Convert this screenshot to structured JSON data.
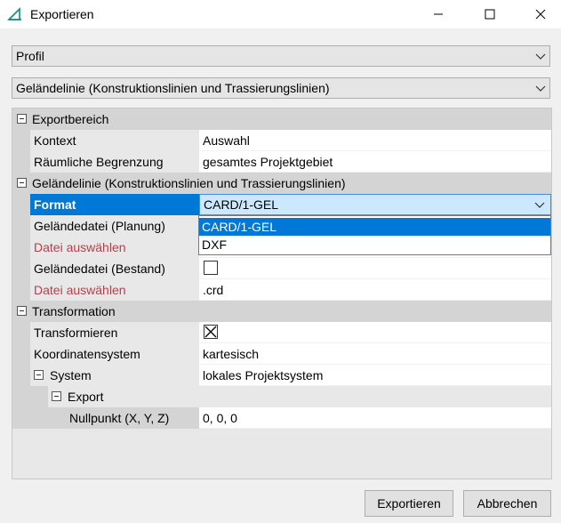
{
  "window": {
    "title": "Exportieren"
  },
  "combos": {
    "profile": "Profil",
    "object": "Geländelinie (Konstruktionslinien und Trassierungslinien)"
  },
  "grid": {
    "export_area": {
      "label": "Exportbereich",
      "context_label": "Kontext",
      "context_value": "Auswahl",
      "spatial_label": "Räumliche Begrenzung",
      "spatial_value": "gesamtes Projektgebiet"
    },
    "terrain": {
      "label": "Geländelinie (Konstruktionslinien und Trassierungslinien)",
      "format_label": "Format",
      "format_value": "CARD/1-GEL",
      "planning_label": "Geländedatei (Planung)",
      "choose_file_1": "Datei auswählen",
      "existing_label": "Geländedatei (Bestand)",
      "choose_file_2": "Datei auswählen",
      "choose_file_2_value": ".crd"
    },
    "transformation": {
      "label": "Transformation",
      "transform_label": "Transformieren",
      "coord_label": "Koordinatensystem",
      "coord_value": "kartesisch",
      "system_label": "System",
      "system_value": "lokales Projektsystem",
      "export_label": "Export",
      "origin_label": "Nullpunkt (X, Y, Z)",
      "origin_value": "0, 0, 0"
    }
  },
  "dropdown": {
    "options": [
      "CARD/1-GEL",
      "DXF"
    ],
    "selected": "CARD/1-GEL"
  },
  "buttons": {
    "export": "Exportieren",
    "cancel": "Abbrechen"
  },
  "colors": {
    "selection": "#0078d7",
    "highlight": "#cce8ff",
    "accent": "#0f8a7a",
    "link_red": "#b4404a"
  }
}
